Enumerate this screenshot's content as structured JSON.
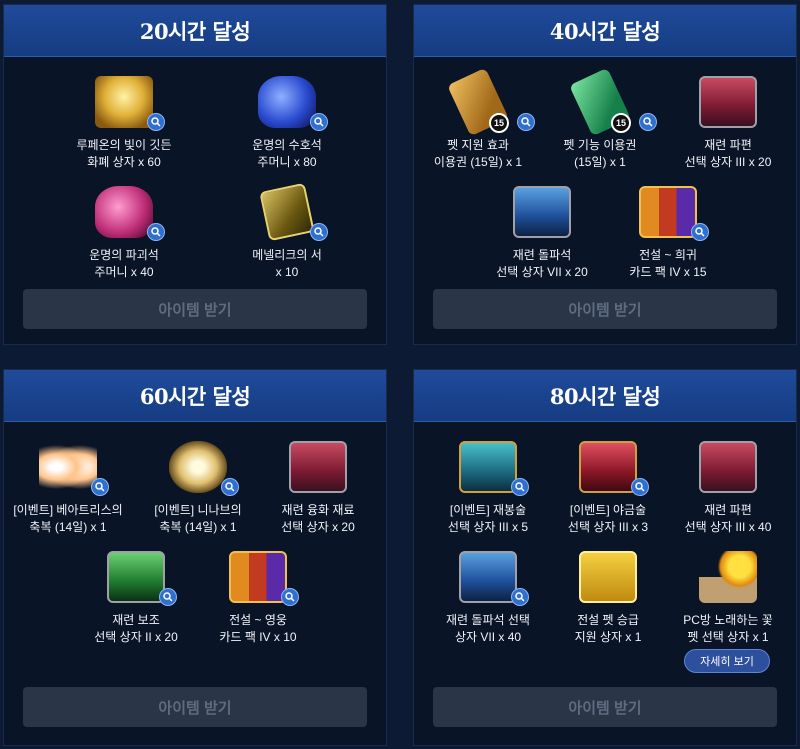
{
  "claim_label": "아이템 받기",
  "panels": [
    {
      "title": "20시간 달성",
      "items": [
        {
          "icon": "gold-chest-icon",
          "line1": "루페온의 빛이 깃든",
          "line2": "화폐 상자 x 60"
        },
        {
          "icon": "blue-pouch-icon",
          "line1": "운명의 수호석",
          "line2": "주머니 x 80"
        },
        {
          "icon": "pink-pouch-icon",
          "line1": "운명의 파괴석",
          "line2": "주머니 x 40"
        },
        {
          "icon": "book-icon",
          "line1": "메넬리크의 서",
          "line2": "x 10"
        }
      ]
    },
    {
      "title": "40시간 달성",
      "items": [
        {
          "icon": "gold-ticket-icon",
          "badge": "15",
          "line1": "펫 지원 효과",
          "line2": "이용권 (15일) x 1"
        },
        {
          "icon": "green-ticket-icon",
          "badge": "15",
          "line1": "펫 기능 이용권",
          "line2": "(15일) x 1"
        },
        {
          "icon": "red-chest-icon",
          "line1": "재련 파편",
          "line2": "선택 상자 III x 20"
        },
        {
          "icon": "blue-chest-icon",
          "line1": "재련 돌파석",
          "line2": "선택 상자 VII x 20"
        },
        {
          "icon": "card-pack-icon",
          "line1": "전설 ~ 희귀",
          "line2": "카드 팩 IV x 15"
        }
      ]
    },
    {
      "title": "60시간 달성",
      "items": [
        {
          "icon": "orange-wings-icon",
          "line1": "[이벤트] 베아트리스의",
          "line2": "축복 (14일) x 1"
        },
        {
          "icon": "gold-wings-icon",
          "line1": "[이벤트] 니나브의",
          "line2": "축복 (14일) x 1"
        },
        {
          "icon": "red-chest-icon",
          "line1": "재련 융화 재료",
          "line2": "선택 상자 x 20"
        },
        {
          "icon": "green-chest-icon",
          "line1": "재련 보조",
          "line2": "선택 상자 II x 20"
        },
        {
          "icon": "card-pack-icon",
          "line1": "전설 ~ 영웅",
          "line2": "카드 팩 IV x 10"
        }
      ]
    },
    {
      "title": "80시간 달성",
      "detail_label": "자세히 보기",
      "items": [
        {
          "icon": "teal-chest-icon",
          "line1": "[이벤트] 재봉술",
          "line2": "선택 상자 III x 5"
        },
        {
          "icon": "crimson-chest-icon",
          "line1": "[이벤트] 야금술",
          "line2": "선택 상자 III x 3"
        },
        {
          "icon": "red-chest-icon",
          "line1": "재련 파편",
          "line2": "선택 상자 III x 40"
        },
        {
          "icon": "blue-chest-icon",
          "line1": "재련 돌파석 선택",
          "line2": "상자 VII x 40"
        },
        {
          "icon": "gift-box-icon",
          "line1": "전설 펫 승급",
          "line2": "지원 상자 x 1"
        },
        {
          "icon": "pet-flower-icon",
          "line1": "PC방 노래하는 꽃",
          "line2": "펫 선택 상자 x 1"
        }
      ]
    }
  ]
}
